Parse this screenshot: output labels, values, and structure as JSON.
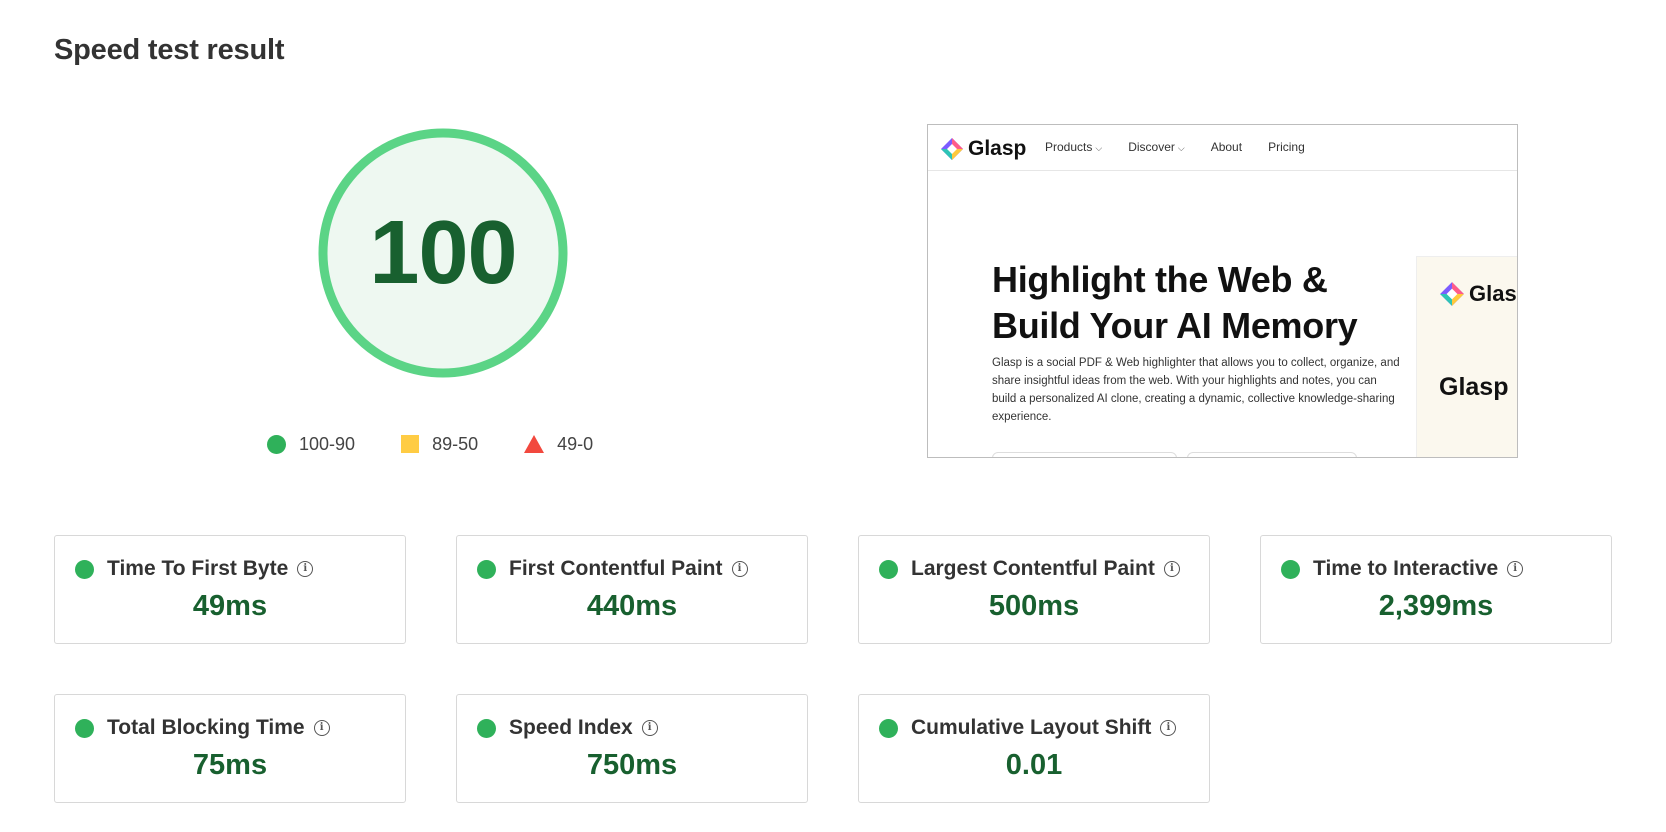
{
  "page": {
    "title": "Speed test result"
  },
  "score": {
    "value": "100",
    "ring_color": "#5bd486",
    "fill_color": "#eef8f1",
    "text_color": "#18602f"
  },
  "legend": [
    {
      "label": "100-90",
      "shape": "circle",
      "color": "#2fb15a"
    },
    {
      "label": "89-50",
      "shape": "square",
      "color": "#ffcc44"
    },
    {
      "label": "49-0",
      "shape": "triangle",
      "color": "#f2483e"
    }
  ],
  "preview": {
    "brand": "Glasp",
    "menu": [
      {
        "label": "Products",
        "has_chevron": true
      },
      {
        "label": "Discover",
        "has_chevron": true
      },
      {
        "label": "About",
        "has_chevron": false
      },
      {
        "label": "Pricing",
        "has_chevron": false
      }
    ],
    "headline": "Highlight the Web & Build Your AI Memory",
    "description": "Glasp is a social PDF & Web highlighter that allows you to collect, organize, and share insightful ideas from the web. With your highlights and notes, you can build a personalized AI clone, creating a dynamic, collective knowledge-sharing experience.",
    "card_brand": "Glasp",
    "card_title": "Glasp"
  },
  "metrics": [
    {
      "label": "Time To First Byte",
      "value": "49ms"
    },
    {
      "label": "First Contentful Paint",
      "value": "440ms"
    },
    {
      "label": "Largest Contentful Paint",
      "value": "500ms"
    },
    {
      "label": "Time to Interactive",
      "value": "2,399ms"
    },
    {
      "label": "Total Blocking Time",
      "value": "75ms"
    },
    {
      "label": "Speed Index",
      "value": "750ms"
    },
    {
      "label": "Cumulative Layout Shift",
      "value": "0.01"
    }
  ],
  "info_icon_glyph": "i",
  "status_color": "#2fb15a"
}
